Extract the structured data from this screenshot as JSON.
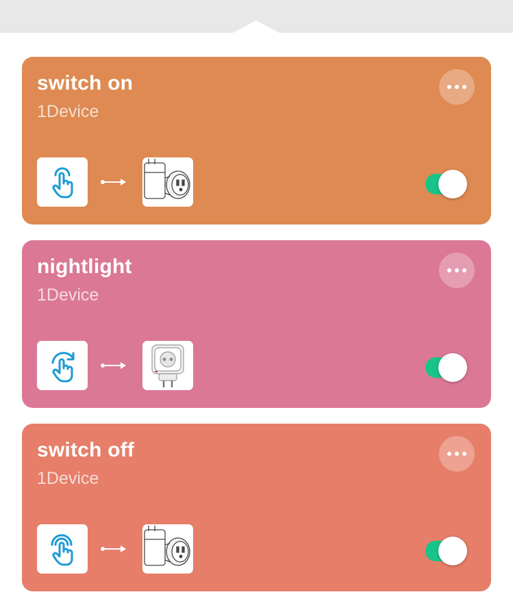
{
  "colors": {
    "toggle_on": "#19c489",
    "icon_blue": "#1a9ad6",
    "top_band": "#e8e8e8"
  },
  "scenes": [
    {
      "title": "switch on",
      "subtitle": "1Device",
      "background": "#de8a52",
      "trigger_icon": "tap-hand-icon",
      "device_icon": "smart-plug-us-icon",
      "enabled": true
    },
    {
      "title": "nightlight",
      "subtitle": "1Device",
      "background": "#db7896",
      "trigger_icon": "rotate-hand-icon",
      "device_icon": "smart-plug-eu-icon",
      "enabled": true
    },
    {
      "title": "switch off",
      "subtitle": "1Device",
      "background": "#e67e69",
      "trigger_icon": "press-hand-icon",
      "device_icon": "smart-plug-us-icon",
      "enabled": true
    }
  ]
}
